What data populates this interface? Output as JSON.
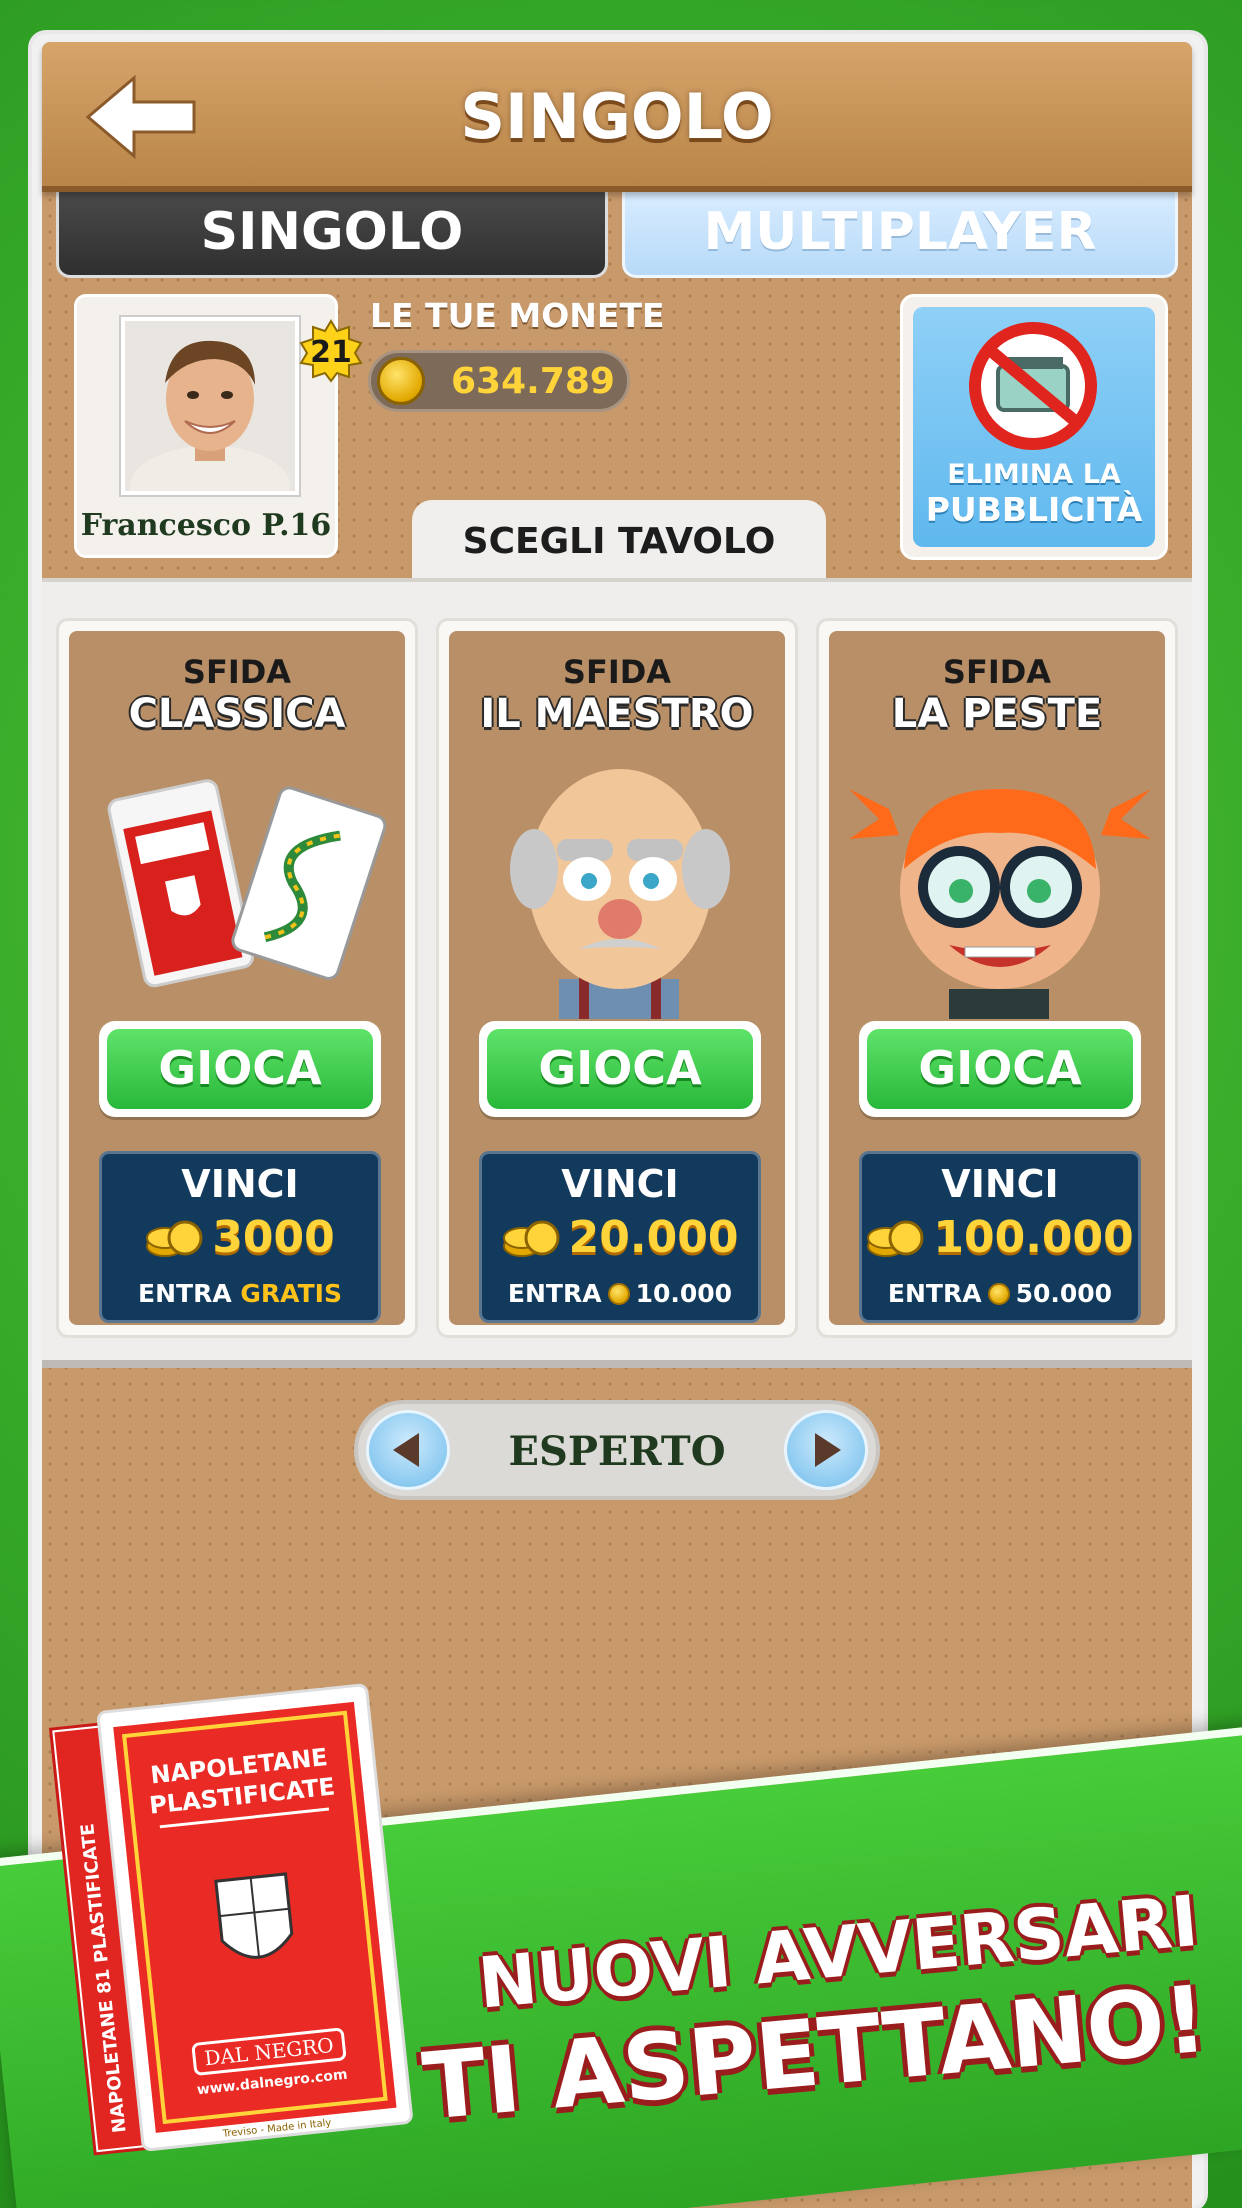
{
  "header": {
    "title": "SINGOLO",
    "back_icon": "arrow-left-icon"
  },
  "mode_tabs": [
    {
      "label": "SINGOLO",
      "active": true
    },
    {
      "label": "MULTIPLAYER",
      "active": false
    }
  ],
  "player": {
    "name": "Francesco P.16",
    "level": "21"
  },
  "coins": {
    "label": "LE TUE MONETE",
    "value": "634.789"
  },
  "ads": {
    "line1": "ELIMINA LA",
    "line2": "PUBBLICITÀ"
  },
  "choose_table": {
    "label": "SCEGLI TAVOLO"
  },
  "tables": [
    {
      "kind": "SFIDA",
      "name": "CLASSICA",
      "play_label": "GIOCA",
      "win_label": "VINCI",
      "prize": "3000",
      "entry_label": "ENTRA",
      "entry_value": "GRATIS"
    },
    {
      "kind": "SFIDA",
      "name": "IL MAESTRO",
      "play_label": "GIOCA",
      "win_label": "VINCI",
      "prize": "20.000",
      "entry_label": "ENTRA",
      "entry_value": "10.000"
    },
    {
      "kind": "SFIDA",
      "name": "LA PESTE",
      "play_label": "GIOCA",
      "win_label": "VINCI",
      "prize": "100.000",
      "entry_label": "ENTRA",
      "entry_value": "50.000"
    }
  ],
  "level_selector": {
    "label": "ESPERTO"
  },
  "promo": {
    "line1": "NUOVI AVVERSARI",
    "line2": "TI ASPETTANO!"
  },
  "deck": {
    "line1": "NAPOLETANE",
    "line2": "PLASTIFICATE",
    "brand": "DAL NEGRO",
    "url": "www.dalnegro.com",
    "side": "NAPOLETANE 81 PLASTIFICATE",
    "made": "Treviso - Made in Italy"
  },
  "colors": {
    "accent_green": "#35a828",
    "header_brown": "#c8996a",
    "prize_blue": "#123a5c",
    "coin_gold": "#ffd43a"
  }
}
